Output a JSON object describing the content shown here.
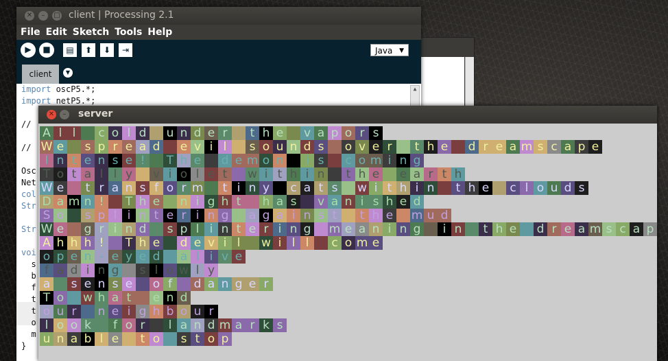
{
  "desktop": {
    "background": "#1b1a17"
  },
  "client_window": {
    "title": "client | Processing 2.1",
    "menu": [
      "File",
      "Edit",
      "Sketch",
      "Tools",
      "Help"
    ],
    "mode": "Java",
    "tab": "client",
    "code_lines": [
      {
        "keyword": "import",
        "rest": " oscP5.*;"
      },
      {
        "keyword": "import",
        "rest": " netP5.*;"
      },
      {
        "keyword": "",
        "rest": ""
      },
      {
        "keyword": "",
        "rest": "//"
      },
      {
        "keyword": "",
        "rest": ""
      },
      {
        "keyword": "",
        "rest": "//"
      },
      {
        "keyword": "",
        "rest": ""
      },
      {
        "keyword": "",
        "rest": "Osc"
      },
      {
        "keyword": "",
        "rest": "Net"
      },
      {
        "keyword": "col",
        "rest": ""
      },
      {
        "keyword": "Str",
        "rest": ""
      },
      {
        "keyword": "",
        "rest": ""
      },
      {
        "keyword": "Str",
        "rest": ""
      },
      {
        "keyword": "",
        "rest": ""
      },
      {
        "keyword": "voi",
        "rest": ""
      },
      {
        "keyword": "",
        "rest": "  s"
      },
      {
        "keyword": "",
        "rest": "  b"
      },
      {
        "keyword": "",
        "rest": "  f"
      },
      {
        "keyword": "",
        "rest": "  t"
      },
      {
        "keyword": "",
        "rest": "  t"
      },
      {
        "keyword": "",
        "rest": "  o"
      },
      {
        "keyword": "",
        "rest": "  m"
      },
      {
        "keyword": "",
        "rest": "}"
      }
    ]
  },
  "server_window": {
    "title": "server",
    "lines": [
      "All cold under the vapors",
      "We spread evil sounds over the dreamscape",
      "Intense! The demon is coming",
      "Totally violet within the earth",
      "We transform tiny cats within the clouds",
      "Damn! The night has vanished",
      "So splintering against the mud",
      "We grind splintering meaning in the dreamscap",
      "Ahhh! The devil will come",
      "open-eyed alive",
      "fading slowly",
      "a sense of danger",
      "To what end",
      "our neighbour",
      "look for landmarks",
      "unable to stop"
    ],
    "palette": [
      "#8a8a8a",
      "#4e7a52",
      "#a06a5c",
      "#5a4e80",
      "#b86a8a",
      "#3c3c3c",
      "#7a8a4e",
      "#5e9aa0",
      "#b0a070",
      "#6a5e4e",
      "#8a6aaa",
      "#2e4e3a",
      "#9ac08a",
      "#c08ad0",
      "#1e1e1e",
      "#7a3e3e",
      "#4e6a8a",
      "#d0b070",
      "#5a8a6a",
      "#000000",
      "#a0a0c0",
      "#cc8866",
      "#3a2e4a",
      "#88aa66"
    ],
    "text_colors": [
      "#b8e0c0",
      "#f0f0a0",
      "#6ab0b0",
      "#4e5a4e",
      "#d8d8ff",
      "#aaddaa",
      "#c0a0e0"
    ]
  }
}
